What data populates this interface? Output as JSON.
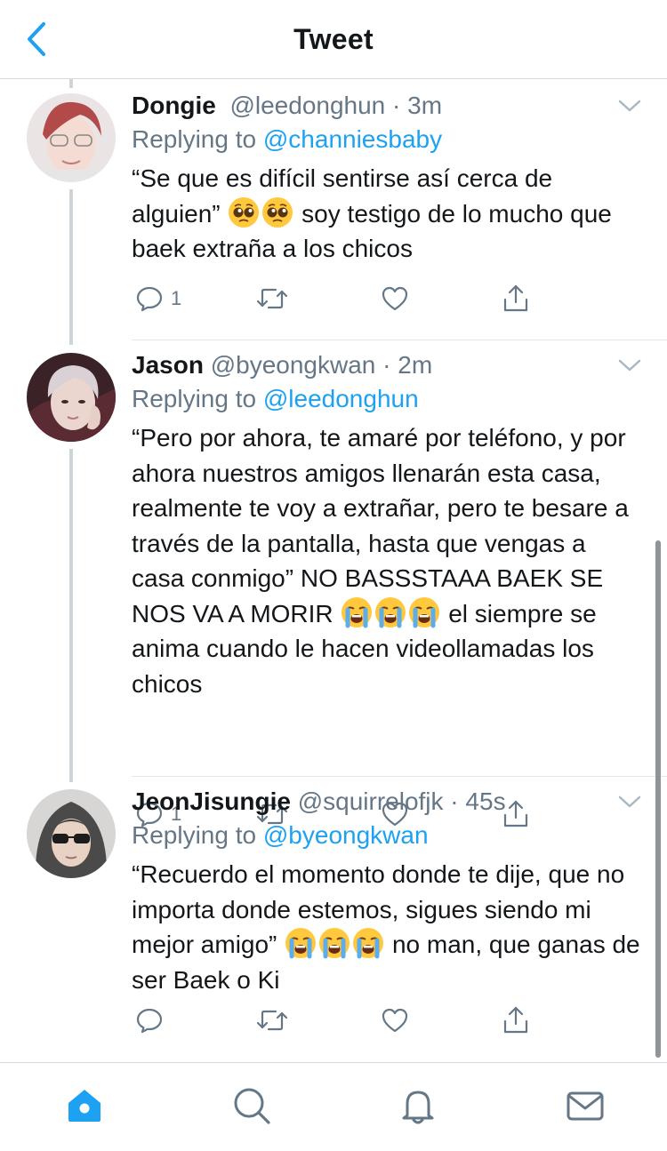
{
  "header": {
    "title": "Tweet"
  },
  "colors": {
    "accent": "#1da1f2",
    "secondary_text": "#657786",
    "thread_line": "#cdd5da"
  },
  "tweets": [
    {
      "name": "Dongie",
      "handle": "@leedonghun",
      "time": "3m",
      "replying_prefix": "Replying to ",
      "replying_to": "@channiesbaby",
      "text_before_emoji": "“Se que es difícil sentirse así cerca de alguien” ",
      "emojis": [
        "pleading-face",
        "pleading-face"
      ],
      "text_after_emoji": " soy testigo de lo mucho que baek extraña a los chicos",
      "reply_count": "1"
    },
    {
      "name": "Jason",
      "handle": "@byeongkwan",
      "time": "2m",
      "replying_prefix": "Replying to ",
      "replying_to": "@leedonghun",
      "text_before_emoji": "“Pero por ahora, te amaré por teléfono, y por ahora nuestros amigos llenarán esta casa, realmente te voy a extrañar, pero te besare a través de la pantalla, hasta que vengas a casa conmigo” NO BASSSTAAA BAEK SE NOS VA A MORIR ",
      "emojis": [
        "loudly-crying-face",
        "loudly-crying-face",
        "loudly-crying-face"
      ],
      "text_after_emoji": " el siempre se anima cuando le hacen videollamadas los chicos",
      "reply_count": "1"
    },
    {
      "name": "JeonJisungie",
      "handle": "@squirrelofjk",
      "time": "45s",
      "replying_prefix": "Replying to ",
      "replying_to": "@byeongkwan",
      "text_before_emoji": "“Recuerdo el momento donde te dije, que no importa donde estemos, sigues siendo mi mejor amigo” ",
      "emojis": [
        "loudly-crying-face",
        "loudly-crying-face",
        "loudly-crying-face"
      ],
      "text_after_emoji": " no man, que ganas de ser Baek o Ki",
      "reply_count": ""
    }
  ],
  "icons": {
    "back": "chevron-left-icon",
    "reply": "reply-icon",
    "retweet": "retweet-icon",
    "like": "heart-icon",
    "share": "share-icon",
    "more": "chevron-down-icon",
    "tabs": [
      "home-icon",
      "search-icon",
      "notifications-icon",
      "messages-icon"
    ]
  }
}
